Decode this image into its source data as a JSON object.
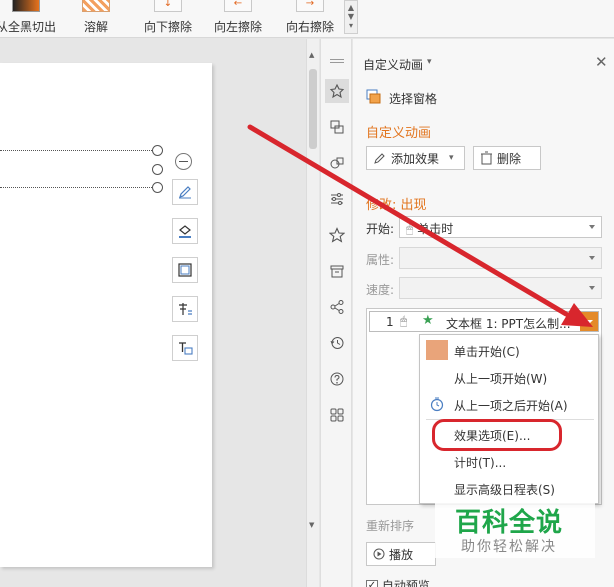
{
  "ribbon": {
    "items": [
      {
        "label": "从全黑切出"
      },
      {
        "label": "溶解"
      },
      {
        "label": "向下擦除"
      },
      {
        "label": "向左擦除"
      },
      {
        "label": "向右擦除"
      }
    ]
  },
  "pane": {
    "header_title": "自定义动画",
    "select_pane_label": "选择窗格",
    "custom_anim_section": "自定义动画",
    "add_effect_label": "添加效果",
    "delete_label": "删除",
    "modify_section": "修改: 出现",
    "start_label": "开始:",
    "start_value": "单击时",
    "property_label": "属性:",
    "speed_label": "速度:",
    "anim_item": {
      "number": "1",
      "text": "文本框 1: PPT怎么制..."
    },
    "reorder_label": "重新排序",
    "play_label": "播放",
    "autopreview_label": "自动预览"
  },
  "context_menu": {
    "items": [
      {
        "label": "单击开始(C)"
      },
      {
        "label": "从上一项开始(W)"
      },
      {
        "label": "从上一项之后开始(A)"
      },
      {
        "label": "效果选项(E)..."
      },
      {
        "label": "计时(T)..."
      },
      {
        "label": "显示高级日程表(S)"
      }
    ]
  },
  "watermark": {
    "line1": "百科全说",
    "line2": "助你轻松解决"
  },
  "colors": {
    "accent_orange": "#e2751f",
    "annotation_red": "#d8262d",
    "watermark_green": "#1fa64a"
  }
}
